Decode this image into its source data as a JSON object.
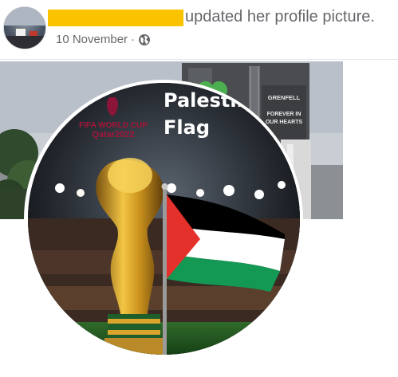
{
  "post": {
    "action_text": "updated her profile picture.",
    "date": "10 November",
    "separator": "·",
    "privacy_icon": "globe-icon"
  },
  "cover_photo": {
    "billboard_lines": [
      "GRENFELL",
      "FOREVER IN",
      "OUR HEARTS"
    ],
    "billboard_color": "#3b3d40",
    "heart_color": "#4caf50"
  },
  "profile_picture": {
    "logo_lines": [
      "FIFA WORLD CUP",
      "Qatar2022"
    ],
    "title_lines": [
      "Palestine",
      "Flag"
    ],
    "flag_colors": {
      "black": "#000000",
      "white": "#ffffff",
      "green": "#149954",
      "red": "#e4312b"
    }
  },
  "colors": {
    "secondary_text": "#65676b",
    "redaction": "#fbc200"
  }
}
